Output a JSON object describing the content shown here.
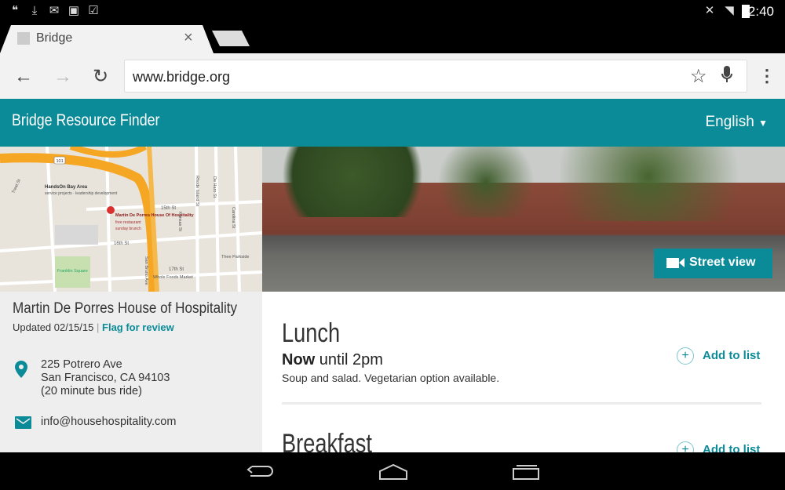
{
  "status_bar": {
    "time": "2:40",
    "icons": [
      "hangouts-icon",
      "download-icon",
      "gmail-icon",
      "photo-icon",
      "clipboard-check-icon"
    ],
    "right_icons": [
      "mute-icon",
      "wifi-icon",
      "battery-icon"
    ]
  },
  "browser": {
    "tab_title": "Bridge",
    "url": "www.bridge.org"
  },
  "header": {
    "title": "Bridge Resource Finder",
    "language": "English"
  },
  "map": {
    "labels": [
      "HandsOn Bay Area",
      "service projects · leadership development",
      "Martin De Porres House Of Hospitality",
      "free restaurant",
      "sunday brunch",
      "15th St",
      "16th St",
      "17th St",
      "Franklin Square",
      "Thee Parkside",
      "Whole Foods Market",
      "Rhode Island St",
      "De Haro St",
      "Kansas St",
      "Carolina St",
      "San Bruno Ave",
      "Treat St",
      "101"
    ]
  },
  "photo": {
    "street_view_label": "Street view"
  },
  "place": {
    "name": "Martin De Porres House of Hospitality",
    "updated": "Updated 02/15/15",
    "separator": "|",
    "flag_label": "Flag for review",
    "address_line1": "225 Potrero Ave",
    "address_line2": "San Francisco, CA 94103",
    "transit": "(20 minute bus ride)",
    "email": "info@househospitality.com"
  },
  "meals": [
    {
      "title": "Lunch",
      "status": "Now",
      "hours": "until 2pm",
      "description": "Soup and salad. Vegetarian option available.",
      "add_label": "Add to list"
    },
    {
      "title": "Breakfast",
      "add_label": "Add to list"
    }
  ],
  "colors": {
    "brand": "#0b8a98"
  }
}
